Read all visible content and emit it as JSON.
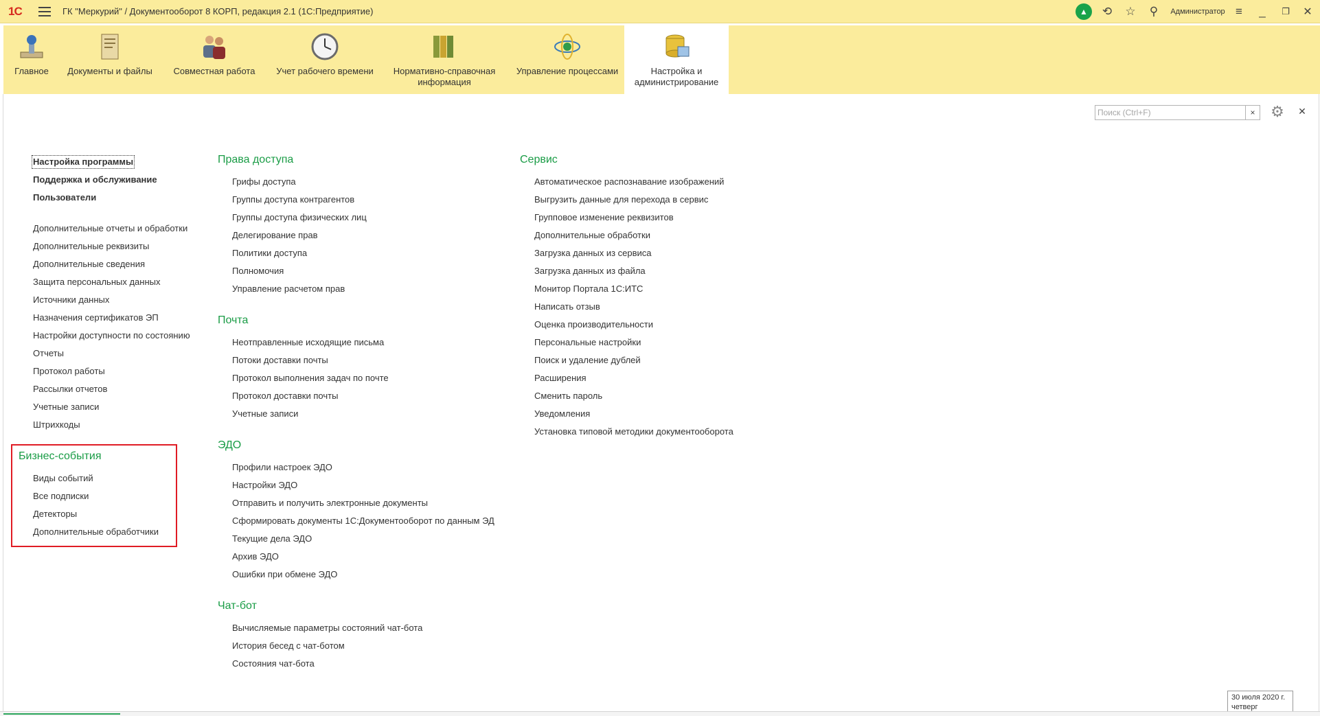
{
  "titlebar": {
    "logo": "1С",
    "title": "ГК \"Меркурий\" / Документооборот 8 КОРП, редакция 2.1  (1С:Предприятие)",
    "user": "Администратор"
  },
  "sections": [
    {
      "label": "Главное",
      "icon": "home-icon"
    },
    {
      "label": "Документы и файлы",
      "icon": "documents-icon"
    },
    {
      "label": "Совместная работа",
      "icon": "people-icon"
    },
    {
      "label": "Учет рабочего времени",
      "icon": "clock-icon"
    },
    {
      "label": "Нормативно-справочная информация",
      "icon": "binders-icon"
    },
    {
      "label": "Управление процессами",
      "icon": "process-icon"
    },
    {
      "label": "Настройка и администрирование",
      "icon": "database-icon",
      "active": true
    }
  ],
  "search": {
    "placeholder": "Поиск (Ctrl+F)"
  },
  "left_column": {
    "top_links": [
      "Настройка программы",
      "Поддержка и обслуживание",
      "Пользователи"
    ],
    "links": [
      "Дополнительные отчеты и обработки",
      "Дополнительные реквизиты",
      "Дополнительные сведения",
      "Защита персональных данных",
      "Источники данных",
      "Назначения сертификатов ЭП",
      "Настройки доступности по состоянию",
      "Отчеты",
      "Протокол работы",
      "Рассылки отчетов",
      "Учетные записи",
      "Штрихкоды"
    ],
    "business_events": {
      "title": "Бизнес-события",
      "links": [
        "Виды событий",
        "Все подписки",
        "Детекторы",
        "Дополнительные обработчики"
      ]
    }
  },
  "middle_column": {
    "access": {
      "title": "Права доступа",
      "links": [
        "Грифы доступа",
        "Группы доступа контрагентов",
        "Группы доступа физических лиц",
        "Делегирование прав",
        "Политики доступа",
        "Полномочия",
        "Управление расчетом прав"
      ]
    },
    "mail": {
      "title": "Почта",
      "links": [
        "Неотправленные исходящие письма",
        "Потоки доставки почты",
        "Протокол выполнения задач по почте",
        "Протокол доставки почты",
        "Учетные записи"
      ]
    },
    "edo": {
      "title": "ЭДО",
      "links": [
        "Профили настроек ЭДО",
        "Настройки ЭДО",
        "Отправить и получить электронные документы",
        "Сформировать документы 1С:Документооборот по данным ЭД",
        "Текущие дела ЭДО",
        "Архив ЭДО",
        "Ошибки при обмене ЭДО"
      ]
    },
    "chatbot": {
      "title": "Чат-бот",
      "links": [
        "Вычисляемые параметры состояний чат-бота",
        "История бесед с чат-ботом",
        "Состояния чат-бота"
      ]
    }
  },
  "right_column": {
    "service": {
      "title": "Сервис",
      "links": [
        "Автоматическое распознавание изображений",
        "Выгрузить данные для перехода в сервис",
        "Групповое изменение реквизитов",
        "Дополнительные обработки",
        "Загрузка данных из сервиса",
        "Загрузка данных из файла",
        "Монитор Портала 1С:ИТС",
        "Написать отзыв",
        "Оценка производительности",
        "Персональные настройки",
        "Поиск и удаление дублей",
        "Расширения",
        "Сменить пароль",
        "Уведомления",
        "Установка типовой методики документооборота"
      ]
    }
  },
  "status": {
    "date": "30 июля 2020 г.",
    "weekday": "четверг"
  },
  "colors": {
    "section_bg": "#fbec9c",
    "group_title": "#1a9c46",
    "highlight": "#e01b24"
  }
}
